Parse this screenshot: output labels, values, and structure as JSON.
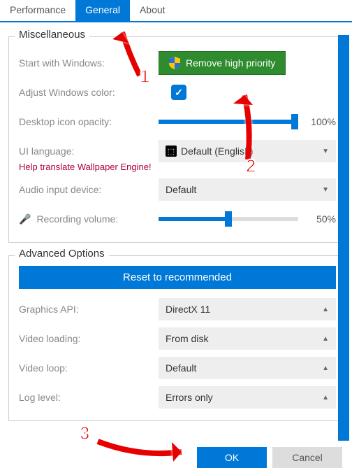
{
  "tabs": {
    "performance": "Performance",
    "general": "General",
    "about": "About"
  },
  "misc": {
    "title": "Miscellaneous",
    "start_with_windows_label": "Start with Windows:",
    "remove_high_priority": "Remove high priority",
    "adjust_color_label": "Adjust Windows color:",
    "desktop_opacity_label": "Desktop icon opacity:",
    "desktop_opacity_value": "100%",
    "ui_language_label": "UI language:",
    "ui_language_value": "Default (English)",
    "help_translate": "Help translate Wallpaper Engine!",
    "audio_device_label": "Audio input device:",
    "audio_device_value": "Default",
    "recording_volume_label": "Recording volume:",
    "recording_volume_value": "50%"
  },
  "adv": {
    "title": "Advanced Options",
    "reset": "Reset to recommended",
    "graphics_api_label": "Graphics API:",
    "graphics_api_value": "DirectX 11",
    "video_loading_label": "Video loading:",
    "video_loading_value": "From disk",
    "video_loop_label": "Video loop:",
    "video_loop_value": "Default",
    "log_level_label": "Log level:",
    "log_level_value": "Errors only"
  },
  "footer": {
    "ok": "OK",
    "cancel": "Cancel"
  },
  "anno": {
    "n1": "1",
    "n2": "2",
    "n3": "3"
  }
}
